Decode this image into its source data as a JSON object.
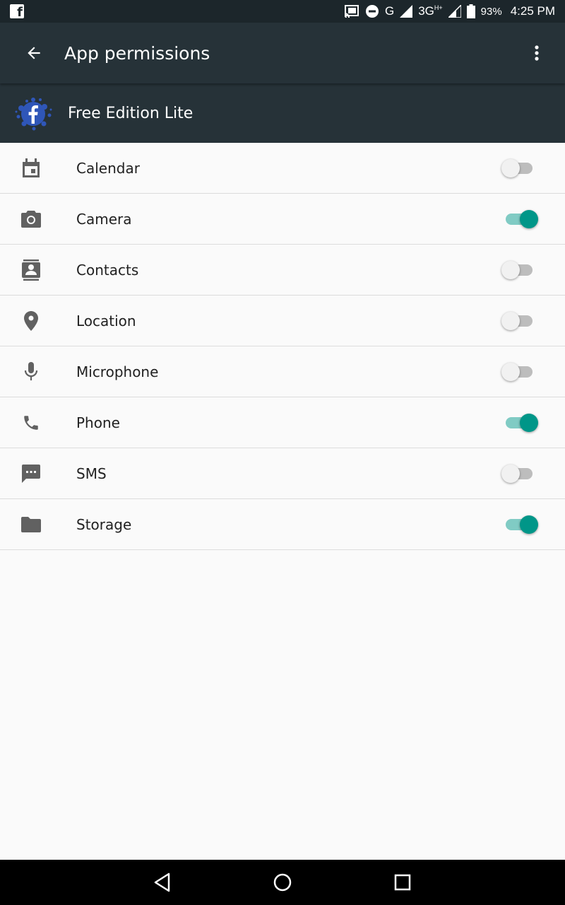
{
  "status_bar": {
    "notification_icon": "facebook-icon",
    "network_g": "G",
    "network_3g": "3G",
    "network_3g_sup": "H+",
    "battery": "93%",
    "time": "4:25 PM"
  },
  "app_bar": {
    "title": "App permissions",
    "back_icon": "arrow-back-icon",
    "overflow_icon": "more-vert-icon"
  },
  "app_header": {
    "app_name": "Free Edition Lite",
    "app_icon": "facebook-splash-icon"
  },
  "permissions": [
    {
      "label": "Calendar",
      "icon": "calendar-icon",
      "enabled": false
    },
    {
      "label": "Camera",
      "icon": "camera-icon",
      "enabled": true
    },
    {
      "label": "Contacts",
      "icon": "contacts-icon",
      "enabled": false
    },
    {
      "label": "Location",
      "icon": "location-pin-icon",
      "enabled": false
    },
    {
      "label": "Microphone",
      "icon": "microphone-icon",
      "enabled": false
    },
    {
      "label": "Phone",
      "icon": "phone-icon",
      "enabled": true
    },
    {
      "label": "SMS",
      "icon": "sms-icon",
      "enabled": false
    },
    {
      "label": "Storage",
      "icon": "folder-icon",
      "enabled": true
    }
  ],
  "colors": {
    "toolbar": "#263238",
    "status_bar": "#1c262b",
    "accent": "#009688",
    "accent_track": "#80cbc4",
    "icon_gray": "#616161"
  },
  "nav_bar": {
    "back": "nav-back-icon",
    "home": "nav-home-icon",
    "recents": "nav-recents-icon"
  }
}
